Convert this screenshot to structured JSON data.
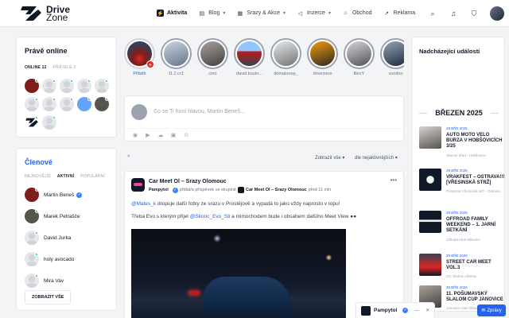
{
  "brand": {
    "line1": "Drive",
    "line2": "Zone"
  },
  "menu": [
    {
      "label": "Aktivita",
      "icon": "activity-icon",
      "active": true
    },
    {
      "label": "Blog",
      "icon": "book-icon",
      "dropdown": true
    },
    {
      "label": "Srazy & Akce",
      "icon": "calendar-icon",
      "dropdown": true
    },
    {
      "label": "Inzerce",
      "icon": "megaphone-icon",
      "dropdown": true
    },
    {
      "label": "Obchod",
      "icon": "bag-icon"
    },
    {
      "label": "Reklama",
      "icon": "chart-icon"
    }
  ],
  "online": {
    "title": "Právě online",
    "tab_online": "ONLINE 12",
    "tab_friends": "PŘÁTELÉ 3"
  },
  "members": {
    "title": "Členové",
    "tabs": [
      "NEJNOVĚJŠÍ",
      "AKTIVNÍ",
      "POPULÁRNÍ"
    ],
    "list": [
      {
        "name": "Martin Beneš",
        "verified": true,
        "photo": true
      },
      {
        "name": "Marek Petrašče",
        "verified": false,
        "photo": true
      },
      {
        "name": "David Jurka",
        "verified": false,
        "photo": false
      },
      {
        "name": "holy avocado",
        "verified": false,
        "photo": false
      },
      {
        "name": "Mira Vav",
        "verified": false,
        "photo": false
      }
    ],
    "show_all": "ZOBRAZIT VŠE"
  },
  "stories": [
    {
      "label": "Příběh",
      "own": true,
      "color": "#7c2d12"
    },
    {
      "label": "f1.2.cr3",
      "color": "#94a3b8"
    },
    {
      "label": "cmo",
      "color": "#78716c"
    },
    {
      "label": "david koutn...",
      "color": "#6b7280"
    },
    {
      "label": "domainoop_",
      "color": "#a3a3a3"
    },
    {
      "label": "drivezone",
      "color": "#57534e"
    },
    {
      "label": "BenY",
      "color": "#9ca3af"
    },
    {
      "label": "voodoo",
      "color": "#64748b"
    }
  ],
  "composer": {
    "placeholder": "Co se Ti honí hlavou, Martin Beneš..."
  },
  "filter": {
    "show": "Zobrazit vše",
    "sort": "dle nejaktivnějších"
  },
  "post": {
    "title": "Car Meet Ol – Srazy Olomouc",
    "author": "Pampytol",
    "action": "přidal/a příspěvek ve skupině",
    "group": "Car Meet Ol – Srazy Olomouc",
    "time": "před 11 min",
    "line1_mention": "@Mates_k",
    "line1_text": " dropuje další fotky ze srazu v Prostějově a vypadá to jako vždy naprosto v topu!",
    "line2_pre": "Třeba Evo s kterým přijel ",
    "line2_mention": "@Skoric_Evo_Sti",
    "line2_post": " a mimochodem bude i obsahem dalšího Meet View ●●"
  },
  "events": {
    "title": "Nadcházející události",
    "month": "BŘEZEN 2025",
    "items": [
      {
        "date": "29 BŘE 2025",
        "title": "AUTO MOTO VELO BURZA V HOBŠOVICÍCH 3/25",
        "loc": "Obecní úřad - Hobšovice",
        "thumb": "#6b7280"
      },
      {
        "date": "29 BŘE 2025",
        "title": "VRAKFEST – OSTRAVA!!! [VŘESINSKÁ STRŽ]",
        "loc": "Pískovna Vřesinská strž - Ostrava",
        "thumb": "#111827"
      },
      {
        "date": "29 BŘE 2025",
        "title": "OFFROAD FAMILY WEEKEND – 1. JARNÍ SETKÁNÍ",
        "loc": "Offroad Klub Milovice",
        "thumb": "#1f2937"
      },
      {
        "date": "29 BŘE 2025",
        "title": "STREET CAR MEET VOL.3",
        "loc": "OC Globus Liberec",
        "thumb": "#374151"
      },
      {
        "date": "30 BŘE 2025",
        "title": "11. POŠUMAVSKÝ SLALOM CUP JANOVICE",
        "loc": "Janovice nad Úhlavou",
        "thumb": "#4b5563"
      }
    ]
  },
  "chat": {
    "name": "Pampytol",
    "messages": "Zprávy"
  }
}
